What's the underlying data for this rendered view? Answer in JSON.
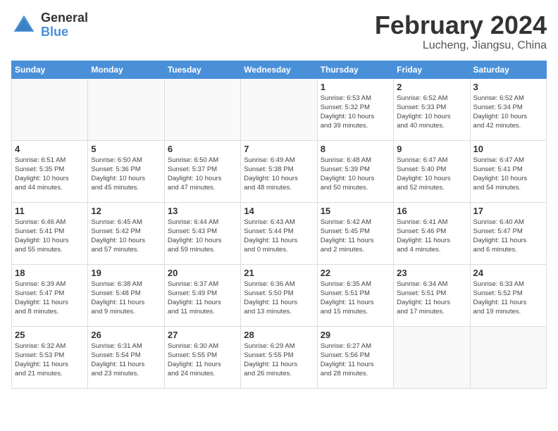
{
  "logo": {
    "general": "General",
    "blue": "Blue"
  },
  "title": "February 2024",
  "location": "Lucheng, Jiangsu, China",
  "weekdays": [
    "Sunday",
    "Monday",
    "Tuesday",
    "Wednesday",
    "Thursday",
    "Friday",
    "Saturday"
  ],
  "weeks": [
    [
      {
        "day": "",
        "info": ""
      },
      {
        "day": "",
        "info": ""
      },
      {
        "day": "",
        "info": ""
      },
      {
        "day": "",
        "info": ""
      },
      {
        "day": "1",
        "info": "Sunrise: 6:53 AM\nSunset: 5:32 PM\nDaylight: 10 hours\nand 39 minutes."
      },
      {
        "day": "2",
        "info": "Sunrise: 6:52 AM\nSunset: 5:33 PM\nDaylight: 10 hours\nand 40 minutes."
      },
      {
        "day": "3",
        "info": "Sunrise: 6:52 AM\nSunset: 5:34 PM\nDaylight: 10 hours\nand 42 minutes."
      }
    ],
    [
      {
        "day": "4",
        "info": "Sunrise: 6:51 AM\nSunset: 5:35 PM\nDaylight: 10 hours\nand 44 minutes."
      },
      {
        "day": "5",
        "info": "Sunrise: 6:50 AM\nSunset: 5:36 PM\nDaylight: 10 hours\nand 45 minutes."
      },
      {
        "day": "6",
        "info": "Sunrise: 6:50 AM\nSunset: 5:37 PM\nDaylight: 10 hours\nand 47 minutes."
      },
      {
        "day": "7",
        "info": "Sunrise: 6:49 AM\nSunset: 5:38 PM\nDaylight: 10 hours\nand 48 minutes."
      },
      {
        "day": "8",
        "info": "Sunrise: 6:48 AM\nSunset: 5:39 PM\nDaylight: 10 hours\nand 50 minutes."
      },
      {
        "day": "9",
        "info": "Sunrise: 6:47 AM\nSunset: 5:40 PM\nDaylight: 10 hours\nand 52 minutes."
      },
      {
        "day": "10",
        "info": "Sunrise: 6:47 AM\nSunset: 5:41 PM\nDaylight: 10 hours\nand 54 minutes."
      }
    ],
    [
      {
        "day": "11",
        "info": "Sunrise: 6:46 AM\nSunset: 5:41 PM\nDaylight: 10 hours\nand 55 minutes."
      },
      {
        "day": "12",
        "info": "Sunrise: 6:45 AM\nSunset: 5:42 PM\nDaylight: 10 hours\nand 57 minutes."
      },
      {
        "day": "13",
        "info": "Sunrise: 6:44 AM\nSunset: 5:43 PM\nDaylight: 10 hours\nand 59 minutes."
      },
      {
        "day": "14",
        "info": "Sunrise: 6:43 AM\nSunset: 5:44 PM\nDaylight: 11 hours\nand 0 minutes."
      },
      {
        "day": "15",
        "info": "Sunrise: 6:42 AM\nSunset: 5:45 PM\nDaylight: 11 hours\nand 2 minutes."
      },
      {
        "day": "16",
        "info": "Sunrise: 6:41 AM\nSunset: 5:46 PM\nDaylight: 11 hours\nand 4 minutes."
      },
      {
        "day": "17",
        "info": "Sunrise: 6:40 AM\nSunset: 5:47 PM\nDaylight: 11 hours\nand 6 minutes."
      }
    ],
    [
      {
        "day": "18",
        "info": "Sunrise: 6:39 AM\nSunset: 5:47 PM\nDaylight: 11 hours\nand 8 minutes."
      },
      {
        "day": "19",
        "info": "Sunrise: 6:38 AM\nSunset: 5:48 PM\nDaylight: 11 hours\nand 9 minutes."
      },
      {
        "day": "20",
        "info": "Sunrise: 6:37 AM\nSunset: 5:49 PM\nDaylight: 11 hours\nand 11 minutes."
      },
      {
        "day": "21",
        "info": "Sunrise: 6:36 AM\nSunset: 5:50 PM\nDaylight: 11 hours\nand 13 minutes."
      },
      {
        "day": "22",
        "info": "Sunrise: 6:35 AM\nSunset: 5:51 PM\nDaylight: 11 hours\nand 15 minutes."
      },
      {
        "day": "23",
        "info": "Sunrise: 6:34 AM\nSunset: 5:51 PM\nDaylight: 11 hours\nand 17 minutes."
      },
      {
        "day": "24",
        "info": "Sunrise: 6:33 AM\nSunset: 5:52 PM\nDaylight: 11 hours\nand 19 minutes."
      }
    ],
    [
      {
        "day": "25",
        "info": "Sunrise: 6:32 AM\nSunset: 5:53 PM\nDaylight: 11 hours\nand 21 minutes."
      },
      {
        "day": "26",
        "info": "Sunrise: 6:31 AM\nSunset: 5:54 PM\nDaylight: 11 hours\nand 23 minutes."
      },
      {
        "day": "27",
        "info": "Sunrise: 6:30 AM\nSunset: 5:55 PM\nDaylight: 11 hours\nand 24 minutes."
      },
      {
        "day": "28",
        "info": "Sunrise: 6:29 AM\nSunset: 5:55 PM\nDaylight: 11 hours\nand 26 minutes."
      },
      {
        "day": "29",
        "info": "Sunrise: 6:27 AM\nSunset: 5:56 PM\nDaylight: 11 hours\nand 28 minutes."
      },
      {
        "day": "",
        "info": ""
      },
      {
        "day": "",
        "info": ""
      }
    ]
  ]
}
